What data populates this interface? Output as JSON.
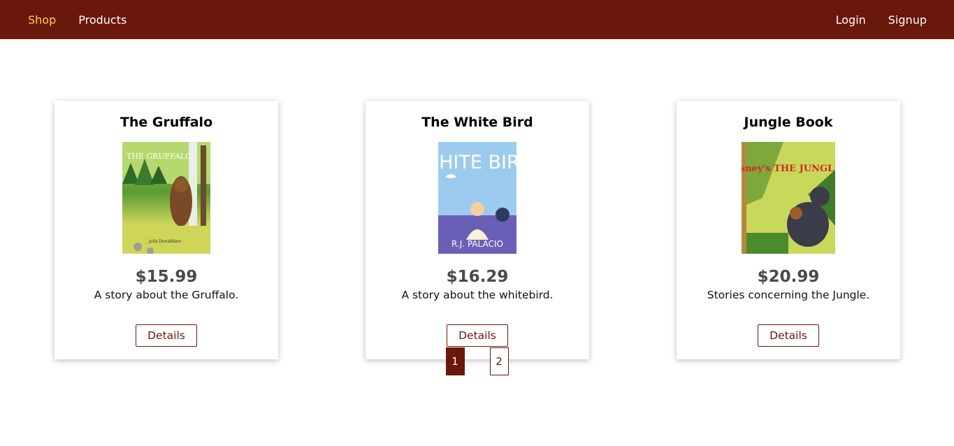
{
  "nav": {
    "left": [
      {
        "label": "Shop",
        "active": true
      },
      {
        "label": "Products",
        "active": false
      }
    ],
    "right": [
      {
        "label": "Login"
      },
      {
        "label": "Signup"
      }
    ]
  },
  "products": [
    {
      "title": "The Gruffalo",
      "price": "$15.99",
      "description": "A story about the Gruffalo.",
      "button": "Details",
      "cover_text": {
        "top": "THE GRUFFALO",
        "bottom": "Julia Donaldson"
      }
    },
    {
      "title": "The White Bird",
      "price": "$16.29",
      "description": "A story about the whitebird.",
      "button": "Details",
      "cover_text": {
        "top": "WHITE BIRD",
        "bottom": "R.J. PALACIO"
      }
    },
    {
      "title": "Jungle Book",
      "price": "$20.99",
      "description": "Stories concerning the Jungle.",
      "button": "Details",
      "cover_text": {
        "top": "Walt Disney's THE JUNGLE BOOK",
        "bottom": ""
      }
    }
  ],
  "pagination": {
    "pages": [
      "1",
      "2"
    ],
    "current": "1"
  },
  "colors": {
    "brand": "#6a170c",
    "nav_active": "#ffd04a",
    "price": "#4a4a4a"
  }
}
